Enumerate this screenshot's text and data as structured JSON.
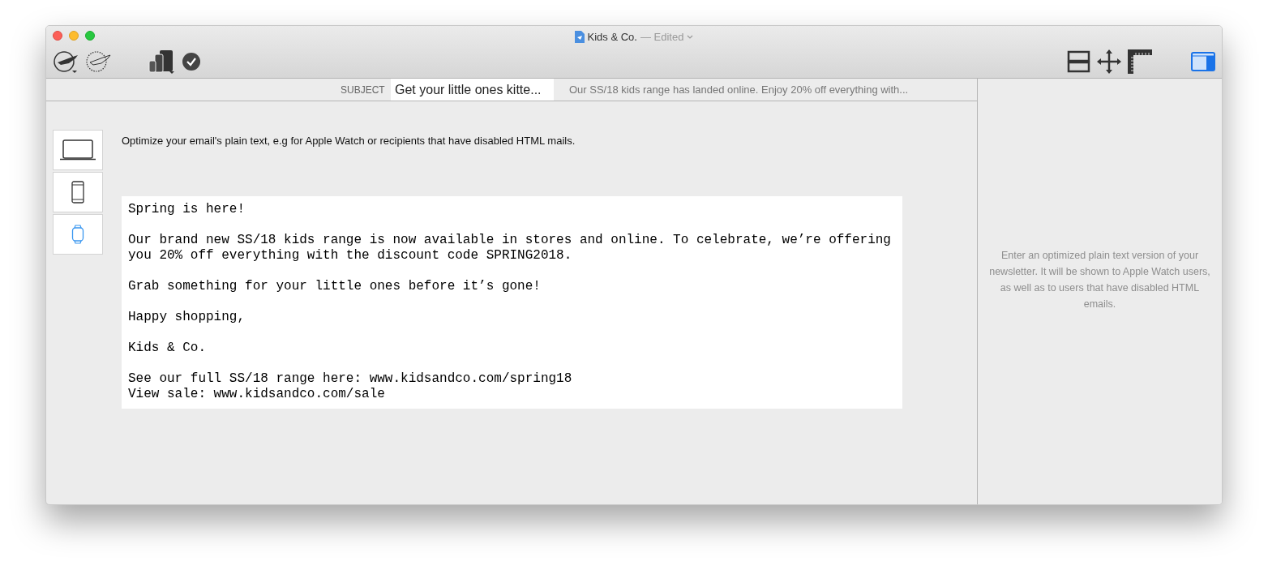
{
  "window": {
    "title": "Kids & Co.",
    "status": "— Edited"
  },
  "subject": {
    "label": "SUBJECT",
    "value": "Get your little ones kitte...",
    "preheader": "Our SS/18 kids range has landed online. Enjoy 20% off everything with..."
  },
  "devices": [
    {
      "kind": "laptop",
      "selected": false
    },
    {
      "kind": "phone",
      "selected": false
    },
    {
      "kind": "watch",
      "selected": true
    }
  ],
  "hint": "Optimize your email's plain text, e.g for Apple Watch or recipients that have disabled HTML mails.",
  "plain_text": [
    [
      "Spring is here!"
    ],
    [
      "Our brand new SS/18 kids range is now available in stores and online. To celebrate, we’re offering",
      "you 20% off everything with the discount code SPRING2018."
    ],
    [
      "Grab something for your little ones before it’s gone!"
    ],
    [
      "Happy shopping,"
    ],
    [
      "Kids & Co."
    ],
    [
      "See our full SS/18 range here: www.kidsandco.com/spring18",
      "View sale: www.kidsandco.com/sale"
    ]
  ],
  "sidebar": {
    "text": "Enter an optimized plain text version of your newsletter. It will be shown to Apple Watch users, as well as to users that have disabled HTML emails.",
    "panel_on": true
  }
}
